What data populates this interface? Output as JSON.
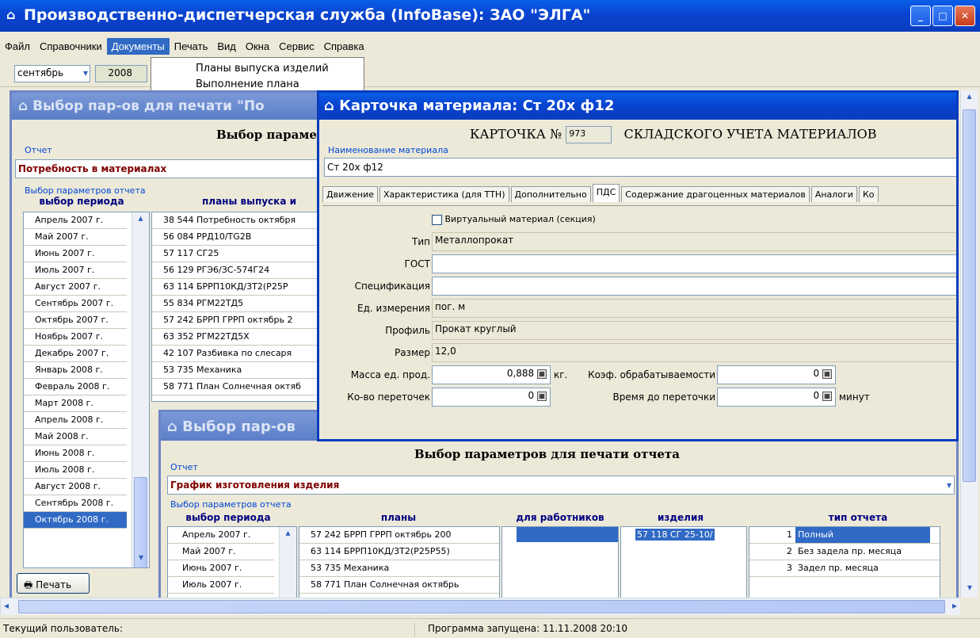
{
  "app": {
    "title": "Производственно-диспетчерская служба (InfoBase): ЗАО \"ЭЛГА\"",
    "menu": [
      "Файл",
      "Справочники",
      "Документы",
      "Печать",
      "Вид",
      "Окна",
      "Сервис",
      "Справка"
    ],
    "dropdown": [
      "Планы выпуска изделий",
      "Выполнение плана"
    ],
    "toolbar": {
      "month": "сентябрь",
      "year": "2008"
    }
  },
  "win1": {
    "title": "Выбор пар-ов для печати \"По",
    "heading": "Выбор параме",
    "report_group": "Отчет",
    "report_value": "Потребность в материалах",
    "params_group": "Выбор параметров отчета",
    "col_period": "выбор периода",
    "col_plans": "планы выпуска и",
    "periods": [
      "Апрель 2007 г.",
      "Май 2007 г.",
      "Июнь 2007 г.",
      "Июль 2007 г.",
      "Август 2007 г.",
      "Сентябрь 2007 г.",
      "Октябрь 2007 г.",
      "Ноябрь 2007 г.",
      "Декабрь 2007 г.",
      "Январь 2008 г.",
      "Февраль 2008 г.",
      "Март 2008 г.",
      "Апрель 2008 г.",
      "Май 2008 г.",
      "Июнь 2008 г.",
      "Июль 2008 г.",
      "Август 2008 г.",
      "Сентябрь 2008 г.",
      "Октябрь 2008 г."
    ],
    "plans": [
      "38 544 Потребность октября",
      "56 084 РРД10/TG2B",
      "57 117 СГ25",
      "56 129 РГЭ6/ЗС-574Г24",
      "63 114 БРРП10КД/3Т2(Р25Р",
      "55 834 РГМ22ТД5",
      "57 242 БРРП ГРРП октябрь 2",
      "63 352 РГМ22ТД5Х",
      "42 107 Разбивка по слесаря",
      "53 735 Механика",
      "58 771 План Солнечная октяб"
    ],
    "print_btn": "Печать"
  },
  "card": {
    "title": "Карточка материала: Ст 20х ф12",
    "header_left": "КАРТОЧКА №",
    "card_no": "973",
    "header_right": "СКЛАДСКОГО УЧЕТА МАТЕРИАЛОВ",
    "name_label": "Наименование материала",
    "name_value": "Ст 20х ф12",
    "tabs": [
      "Движение",
      "Характеристика (для ТТН)",
      "Дополнительно",
      "ПДС",
      "Содержание драгоценных материалов",
      "Аналоги",
      "Ко"
    ],
    "virtual": "Виртуальный материал (секция)",
    "labels": {
      "type": "Тип",
      "gost": "ГОСТ",
      "spec": "Спецификация",
      "unit": "Ед. измерения",
      "profile": "Профиль",
      "size": "Размер",
      "mass": "Масса ед. прод.",
      "kg": "кг.",
      "coef": "Коэф. обрабатываемости",
      "count": "Ко-во переточек",
      "time": "Время до переточки",
      "min": "минут"
    },
    "values": {
      "type": "Металлопрокат",
      "gost": "",
      "spec": "",
      "unit": "пог. м",
      "profile": "Прокат круглый",
      "size": "12,0",
      "mass": "0,888",
      "coef": "0",
      "count": "0",
      "time": "0"
    }
  },
  "win2": {
    "title": "Выбор пар-ов",
    "heading": "Выбор параметров для печати отчета",
    "report_group": "Отчет",
    "report_value": "График изготовления изделия",
    "params_group": "Выбор параметров отчета",
    "col_period": "выбор периода",
    "col_plans": "планы",
    "col_workers": "для работников",
    "col_items": "изделия",
    "col_type": "тип отчета",
    "periods": [
      "Апрель 2007 г.",
      "Май 2007 г.",
      "Июнь 2007 г.",
      "Июль 2007 г."
    ],
    "plans": [
      "57 242 БРРП ГРРП октябрь 200",
      "63 114 БРРП10КД/3Т2(Р25Р55)",
      "53 735 Механика",
      "58 771 План Солнечная октябрь"
    ],
    "item": "57 118 СГ 25-10/",
    "types": [
      {
        "n": "1",
        "t": "Полный"
      },
      {
        "n": "2",
        "t": "Без задела пр. месяца"
      },
      {
        "n": "3",
        "t": "Задел пр. месяца"
      }
    ]
  },
  "status": {
    "user": "Текущий пользователь:",
    "started": "Программа запущена: 11.11.2008 20:10"
  }
}
